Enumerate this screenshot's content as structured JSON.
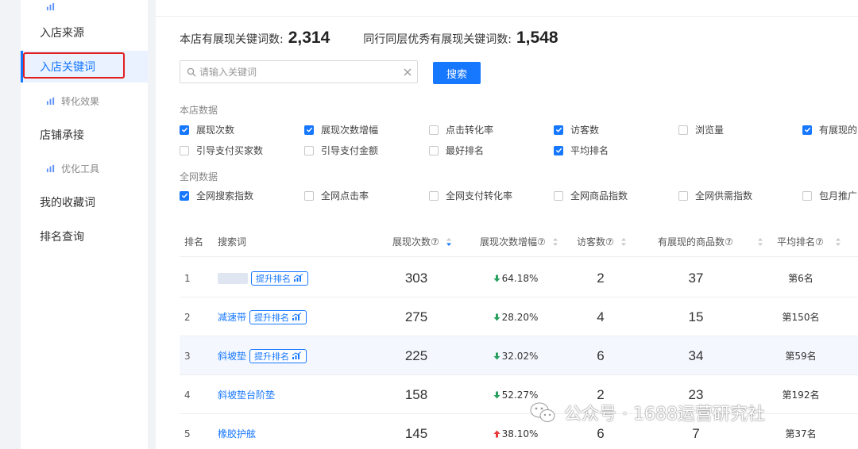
{
  "sidebar": {
    "items": [
      {
        "label": "入店来源"
      },
      {
        "label": "入店关键词"
      },
      {
        "label": "转化效果"
      },
      {
        "label": "店铺承接"
      },
      {
        "label": "优化工具"
      },
      {
        "label": "我的收藏词"
      },
      {
        "label": "排名查询"
      }
    ]
  },
  "stats": {
    "own_label": "本店有展现关键词数:",
    "own_value": "2,314",
    "peer_label": "同行同层优秀有展现关键词数:",
    "peer_value": "1,548"
  },
  "search": {
    "placeholder": "请输入关键词",
    "button": "搜索"
  },
  "store_data": {
    "label": "本店数据",
    "options": [
      {
        "label": "展现次数",
        "checked": true
      },
      {
        "label": "展现次数增幅",
        "checked": true
      },
      {
        "label": "点击转化率",
        "checked": false
      },
      {
        "label": "访客数",
        "checked": true
      },
      {
        "label": "浏览量",
        "checked": false
      },
      {
        "label": "有展现的",
        "checked": true
      },
      {
        "label": "引导支付买家数",
        "checked": false
      },
      {
        "label": "引导支付金额",
        "checked": false
      },
      {
        "label": "最好排名",
        "checked": false
      },
      {
        "label": "平均排名",
        "checked": true
      }
    ]
  },
  "network_data": {
    "label": "全网数据",
    "options": [
      {
        "label": "全网搜索指数",
        "checked": true
      },
      {
        "label": "全网点击率",
        "checked": false
      },
      {
        "label": "全网支付转化率",
        "checked": false
      },
      {
        "label": "全网商品指数",
        "checked": false
      },
      {
        "label": "全网供需指数",
        "checked": false
      },
      {
        "label": "包月推广",
        "checked": false
      }
    ]
  },
  "table": {
    "headers": {
      "rank": "排名",
      "keyword": "搜索词",
      "impressions": "展现次数⑦",
      "growth": "展现次数增幅⑦",
      "visitors": "访客数⑦",
      "products": "有展现的商品数⑦",
      "avg_rank": "平均排名⑦"
    },
    "tag_label": "提升排名",
    "rows": [
      {
        "rank": "1",
        "keyword": "",
        "has_tag": true,
        "blurred": true,
        "impressions": "303",
        "growth": "64.18%",
        "dir": "down",
        "visitors": "2",
        "products": "37",
        "avg_rank": "第6名"
      },
      {
        "rank": "2",
        "keyword": "减速带",
        "has_tag": true,
        "blurred": false,
        "impressions": "275",
        "growth": "28.20%",
        "dir": "down",
        "visitors": "4",
        "products": "15",
        "avg_rank": "第150名"
      },
      {
        "rank": "3",
        "keyword": "斜坡垫",
        "has_tag": true,
        "blurred": false,
        "impressions": "225",
        "growth": "32.02%",
        "dir": "down",
        "visitors": "6",
        "products": "34",
        "avg_rank": "第59名"
      },
      {
        "rank": "4",
        "keyword": "斜坡垫台阶垫",
        "has_tag": false,
        "blurred": false,
        "impressions": "158",
        "growth": "52.27%",
        "dir": "down",
        "visitors": "2",
        "products": "23",
        "avg_rank": "第192名"
      },
      {
        "rank": "5",
        "keyword": "橡胶护舷",
        "has_tag": false,
        "blurred": false,
        "impressions": "145",
        "growth": "38.10%",
        "dir": "up",
        "visitors": "6",
        "products": "7",
        "avg_rank": "第37名"
      }
    ]
  },
  "watermark": {
    "text": "公众号 · 1688运营研究社"
  },
  "colors": {
    "accent": "#1677ff",
    "down": "#28a060",
    "up": "#e8393a",
    "highlight": "#e02020"
  }
}
